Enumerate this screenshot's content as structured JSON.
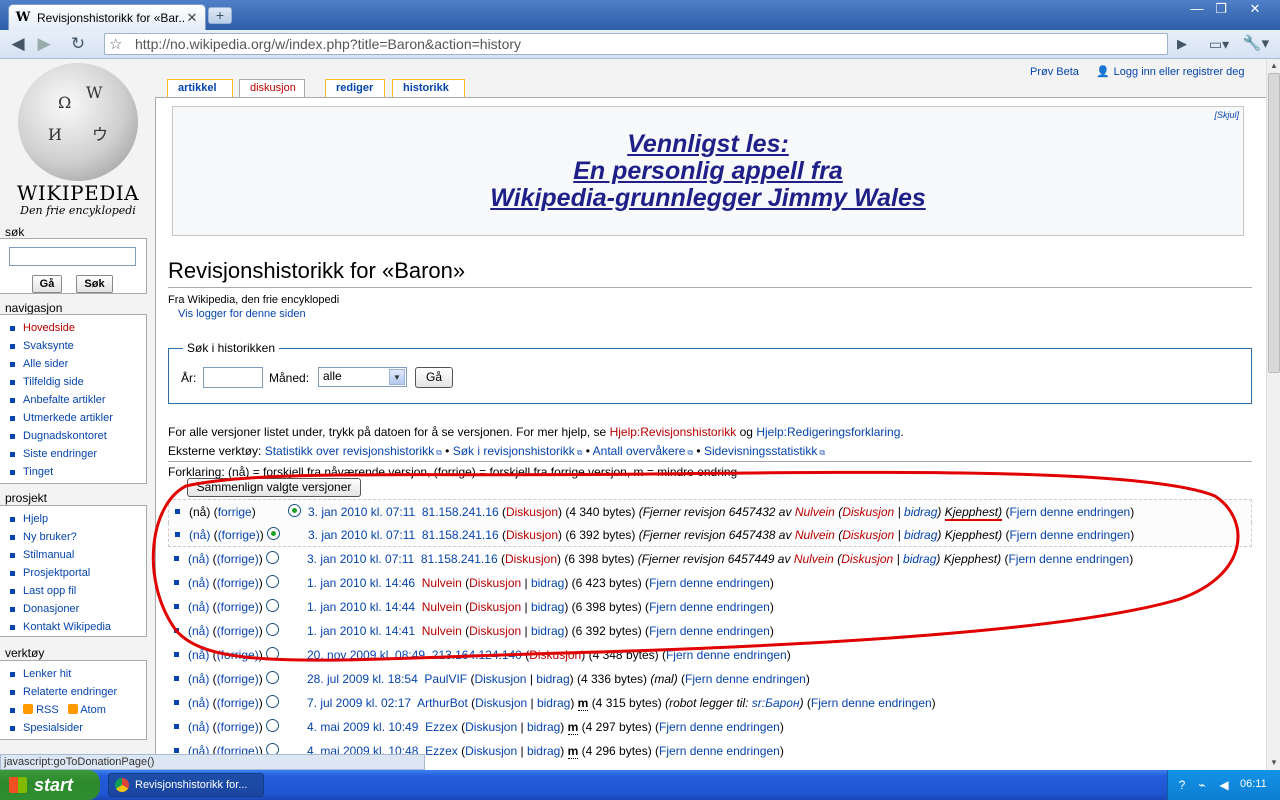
{
  "browser": {
    "tab_title": "Revisjonshistorikk for «Bar...",
    "tab_favicon": "W",
    "url": "http://no.wikipedia.org/w/index.php?title=Baron&action=history",
    "status_text": "javascript:goToDonationPage()"
  },
  "sidebar": {
    "logo_wordmark": "WIKIPEDIA",
    "logo_slogan": "Den frie encyklopedi",
    "search_heading": "søk",
    "go_button": "Gå",
    "search_button": "Søk",
    "nav_heading": "navigasjon",
    "nav_items": [
      "Hovedside",
      "Svaksynte",
      "Alle sider",
      "Tilfeldig side",
      "Anbefalte artikler",
      "Utmerkede artikler",
      "Dugnadskontoret",
      "Siste endringer",
      "Tinget"
    ],
    "project_heading": "prosjekt",
    "project_items": [
      "Hjelp",
      "Ny bruker?",
      "Stilmanual",
      "Prosjektportal",
      "Last opp fil",
      "Donasjoner",
      "Kontakt Wikipedia"
    ],
    "tools_heading": "verktøy",
    "tools_items": [
      "Lenker hit",
      "Relaterte endringer"
    ],
    "tools_rss": "RSS",
    "tools_atom": "Atom",
    "tools_special": "Spesialsider"
  },
  "personal": {
    "beta": "Prøv Beta",
    "login": "Logg inn eller registrer deg"
  },
  "tabs": {
    "article": "artikkel",
    "discussion": "diskusjon",
    "edit": "rediger",
    "history": "historikk"
  },
  "notice": {
    "hide": "[Skjul]",
    "line1": "Vennligst les:",
    "line2": "En personlig appell fra",
    "line3": "Wikipedia-grunnlegger Jimmy Wales"
  },
  "page": {
    "title": "Revisjonshistorikk for «Baron»",
    "subtitle": "Fra Wikipedia, den frie encyklopedi",
    "log_link": "Vis logger for denne siden",
    "search_legend": "Søk i historikken",
    "year_label": "År:",
    "month_label": "Måned:",
    "month_value": "alle",
    "go": "Gå",
    "help_text": "For alle versjoner listet under, trykk på datoen for å se versjonen. For mer hjelp, se",
    "help_link1": "Hjelp:Revisjonshistorikk",
    "help_and": "og",
    "help_link2": "Hjelp:Redigeringsforklaring",
    "ext_label": "Eksterne verktøy:",
    "ext1": "Statistikk over revisjonshistorikk",
    "ext2": "Søk i revisjonshistorikk",
    "ext3": "Antall overvåkere",
    "ext4": "Sidevisningsstatistikk",
    "legend_text": "Forklaring: (nå) = forskjell fra nåværende versjon, (forrige) = forskjell fra forrige versjon, m = mindre endring",
    "compare_button": "Sammenlign valgte versjoner"
  },
  "history": [
    {
      "date": "3. jan 2010 kl. 07:11",
      "user": "81.158.241.16",
      "talk": "Diskusjon",
      "size": "(4 340 bytes)",
      "summary_pre": "(Fjerner revisjon 6457432 av",
      "summary_user": "Nulvein",
      "summary_talk": "Diskusjon",
      "summary_contrib": "bidrag",
      "summary_post": "Kjepphest)",
      "undo": "Fjern denne endringen"
    },
    {
      "date": "3. jan 2010 kl. 07:11",
      "user": "81.158.241.16",
      "talk": "Diskusjon",
      "size": "(6 392 bytes)",
      "summary_pre": "(Fjerner revisjon 6457438 av",
      "summary_user": "Nulvein",
      "summary_talk": "Diskusjon",
      "summary_contrib": "bidrag",
      "summary_post": "Kjepphest)",
      "undo": "Fjern denne endringen"
    },
    {
      "date": "3. jan 2010 kl. 07:11",
      "user": "81.158.241.16",
      "talk": "Diskusjon",
      "size": "(6 398 bytes)",
      "summary_pre": "(Fjerner revisjon 6457449 av",
      "summary_user": "Nulvein",
      "summary_talk": "Diskusjon",
      "summary_contrib": "bidrag",
      "summary_post": "Kjepphest)",
      "undo": "Fjern denne endringen"
    },
    {
      "date": "1. jan 2010 kl. 14:46",
      "user": "Nulvein",
      "talk": "Diskusjon",
      "contrib": "bidrag",
      "size": "(6 423 bytes)",
      "undo": "Fjern denne endringen"
    },
    {
      "date": "1. jan 2010 kl. 14:44",
      "user": "Nulvein",
      "talk": "Diskusjon",
      "contrib": "bidrag",
      "size": "(6 398 bytes)",
      "undo": "Fjern denne endringen"
    },
    {
      "date": "1. jan 2010 kl. 14:41",
      "user": "Nulvein",
      "talk": "Diskusjon",
      "contrib": "bidrag",
      "size": "(6 392 bytes)",
      "undo": "Fjern denne endringen"
    },
    {
      "date": "20. nov 2009 kl. 08:49",
      "user": "213.164.124.140",
      "talk": "Diskusjon",
      "size": "(4 348 bytes)",
      "undo": "Fjern denne endringen"
    },
    {
      "date": "28. jul 2009 kl. 18:54",
      "user": "PaulVIF",
      "talk": "Diskusjon",
      "contrib": "bidrag",
      "size": "(4 336 bytes)",
      "summary": "(mal)",
      "undo": "Fjern denne endringen"
    },
    {
      "date": "7. jul 2009 kl. 02:17",
      "user": "ArthurBot",
      "talk": "Diskusjon",
      "contrib": "bidrag",
      "minor": "m",
      "size": "(4 315 bytes)",
      "summary_bot": "(robot legger til:",
      "summary_bot_link": "sr:Барон",
      "undo": "Fjern denne endringen"
    },
    {
      "date": "4. mai 2009 kl. 10:49",
      "user": "Ezzex",
      "talk": "Diskusjon",
      "contrib": "bidrag",
      "minor": "m",
      "size": "(4 297 bytes)",
      "undo": "Fjern denne endringen"
    },
    {
      "date": "4. mai 2009 kl. 10:48",
      "user": "Ezzex",
      "talk": "Diskusjon",
      "contrib": "bidrag",
      "minor": "m",
      "size": "(4 296 bytes)",
      "undo": "Fjern denne endringen"
    }
  ],
  "row_cur": "(nå)",
  "row_prev": "(forrige)",
  "taskbar": {
    "start": "start",
    "item": "Revisjonshistorikk for...",
    "clock": "06:11"
  },
  "icons": [
    "wikipedia-favicon",
    "back-icon",
    "forward-icon",
    "reload-icon",
    "star-icon",
    "go-icon",
    "page-menu-icon",
    "wrench-icon",
    "user-icon",
    "rss-icon",
    "external-link-icon",
    "windows-flag-icon",
    "chrome-icon"
  ],
  "colors": {
    "link": "#0645ad",
    "redlink": "#ba0000",
    "annotation": "#e00000",
    "taskbar": "#245edb"
  }
}
